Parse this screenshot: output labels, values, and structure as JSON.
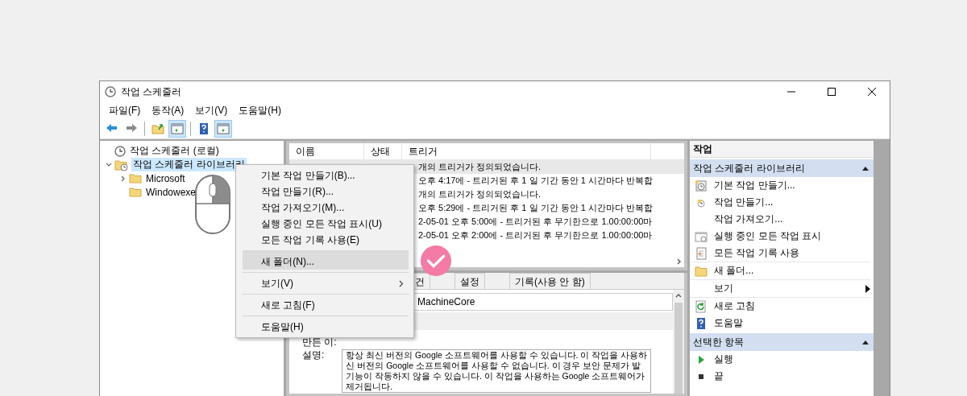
{
  "window": {
    "title": "작업 스케줄러"
  },
  "menu_bar": [
    "파일(F)",
    "동작(A)",
    "보기(V)",
    "도움말(H)"
  ],
  "toolbar": [
    {
      "kind": "back",
      "pressed": false
    },
    {
      "kind": "forward",
      "pressed": false
    },
    {
      "kind": "separator"
    },
    {
      "kind": "folder-up",
      "pressed": false
    },
    {
      "kind": "left-pane",
      "pressed": true
    },
    {
      "kind": "separator"
    },
    {
      "kind": "help",
      "pressed": false
    },
    {
      "kind": "right-pane",
      "pressed": true
    }
  ],
  "tree": [
    {
      "label": "작업 스케줄러 (로컬)",
      "kind": "clock",
      "selected": false,
      "has_children": false
    },
    {
      "label": "작업 스케줄러 라이브러리",
      "kind": "library",
      "selected": true,
      "expanded": true,
      "has_children": true,
      "children": [
        {
          "label": "Microsoft",
          "kind": "folder",
          "selected": false,
          "expanded": false,
          "has_children": true
        },
        {
          "label": "Windowexe",
          "kind": "folder",
          "selected": false,
          "has_children": false
        }
      ]
    }
  ],
  "task_list": {
    "columns": [
      "이름",
      "상태",
      "트리거"
    ],
    "rows": [
      {
        "trigger": "개의 트리거가 정의되었습니다.",
        "selected": true
      },
      {
        "trigger": "오후 4:17에 - 트리거된 후 1 일 기간 동안 1 시간마다 반복합",
        "selected": false
      },
      {
        "trigger": "개의 트리거가 정의되었습니다.",
        "selected": false
      },
      {
        "trigger": "오후 5:29에 - 트리거된 후 1 일 기간 동안 1 시간마다 반복합",
        "selected": false
      },
      {
        "trigger": "2-05-01 오후 5:00에 - 트리거된 후 무기한으로 1.00:00:00마",
        "selected": false
      },
      {
        "trigger": "2-05-01 오후 2:00에 - 트리거된 후 무기한으로 1.00:00:00마",
        "selected": false
      }
    ]
  },
  "detail_tabs": [
    {
      "label": "건",
      "selected": false
    },
    {
      "label": "설정",
      "selected": false
    },
    {
      "label": "기록(사용 안 함)",
      "selected": false
    }
  ],
  "details": {
    "name_value": "MachineCore",
    "author_label": "만든 이:",
    "description_label": "설명:",
    "description_lines": [
      "항상 최신 버전의 Google 소프트웨어를 사용할 수 있습니다. 이 작업을 사용하",
      "신 버전의 Google 소프트웨어를 사용할 수 없습니다. 이 경우 보안 문제가 발",
      "기능이 작동하지 않을 수 있습니다. 이 작업을 사용하는 Google 소프트웨어가",
      "제거됩니다."
    ]
  },
  "context_menu": [
    {
      "label": "기본 작업 만들기(B)...",
      "selected": false,
      "has_submenu": false,
      "separator_before": false
    },
    {
      "label": "작업 만들기(R)...",
      "selected": false,
      "has_submenu": false,
      "separator_before": false
    },
    {
      "label": "작업 가져오기(M)...",
      "selected": false,
      "has_submenu": false,
      "separator_before": false
    },
    {
      "label": "실행 중인 모든 작업 표시(U)",
      "selected": false,
      "has_submenu": false,
      "separator_before": false
    },
    {
      "label": "모든 작업 기록 사용(E)",
      "selected": false,
      "has_submenu": false,
      "separator_before": false
    },
    {
      "label": "새 폴더(N)...",
      "selected": true,
      "has_submenu": false,
      "separator_before": true
    },
    {
      "label": "보기(V)",
      "selected": false,
      "has_submenu": true,
      "separator_before": true
    },
    {
      "label": "새로 고침(F)",
      "selected": false,
      "has_submenu": false,
      "separator_before": true
    },
    {
      "label": "도움말(H)",
      "selected": false,
      "has_submenu": false,
      "separator_before": true
    }
  ],
  "actions": {
    "title": "작업",
    "sections": [
      {
        "title": "작업 스케줄러 라이브러리",
        "expanded": true,
        "items": [
          {
            "label": "기본 작업 만들기...",
            "kind": "basic-task",
            "separator_before": false
          },
          {
            "label": "작업 만들기...",
            "kind": "create-task",
            "separator_before": false
          },
          {
            "label": "작업 가져오기...",
            "kind": "none",
            "separator_before": false
          },
          {
            "label": "실행 중인 모든 작업 표시",
            "kind": "running",
            "separator_before": false
          },
          {
            "label": "모든 작업 기록 사용",
            "kind": "history",
            "separator_before": false
          },
          {
            "label": "새 폴더...",
            "kind": "folder",
            "separator_before": true
          },
          {
            "label": "보기",
            "kind": "submenu",
            "separator_before": true
          },
          {
            "label": "새로 고침",
            "kind": "refresh",
            "separator_before": true
          },
          {
            "label": "도움말",
            "kind": "help",
            "separator_before": false
          }
        ]
      },
      {
        "title": "선택한 항목",
        "expanded": true,
        "items": [
          {
            "label": "실행",
            "kind": "run",
            "separator_before": false
          },
          {
            "label": "끝",
            "kind": "end",
            "separator_before": false
          }
        ]
      }
    ]
  }
}
